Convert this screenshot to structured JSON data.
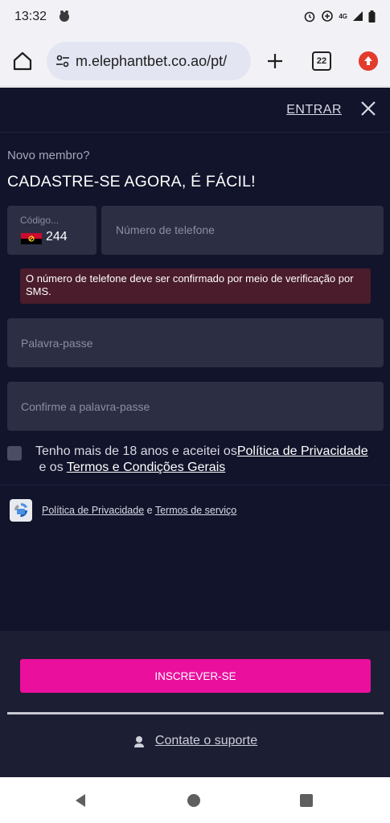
{
  "status_bar": {
    "time": "13:32",
    "network": "4G",
    "icons": [
      "app-notification-icon",
      "alarm-icon",
      "data-saver-icon",
      "signal-icon",
      "battery-icon"
    ]
  },
  "browser": {
    "url": "m.elephantbet.co.ao/pt/",
    "tab_count": "22",
    "icons": [
      "home-icon",
      "site-settings-icon",
      "new-tab-icon",
      "tab-switcher-icon",
      "update-icon"
    ]
  },
  "header": {
    "login_label": "ENTRAR",
    "close_icon": "close-icon"
  },
  "form": {
    "subtitle": "Novo membro?",
    "title": "CADASTRE-SE AGORA, É FÁCIL!",
    "code_label": "Código...",
    "code_value": "244",
    "code_flag": "angola-flag-icon",
    "phone_placeholder": "Número de telefone",
    "sms_notice": "O número de telefone deve ser confirmado por meio de verificação por SMS.",
    "password_placeholder": "Palavra-passe",
    "confirm_placeholder": "Confirme a palavra-passe",
    "terms_prefix": "Tenho mais de 18 anos e aceitei os",
    "terms_privacy_link": "Política de Privacidade",
    "terms_middle": " e os ",
    "terms_link": "Termos e Condições Gerais"
  },
  "recaptcha": {
    "privacy_link": "Política de Privacidade",
    "joiner": " e ",
    "terms_link": "Termos de serviço"
  },
  "footer": {
    "submit_label": "INSCREVER-SE",
    "support_label": "Contate o suporte"
  },
  "colors": {
    "page_bg": "#12142b",
    "field_bg": "#2c2e44",
    "alert_bg": "#4a1c2c",
    "accent": "#ea0f9d",
    "footer_bg": "#1c1e33"
  }
}
